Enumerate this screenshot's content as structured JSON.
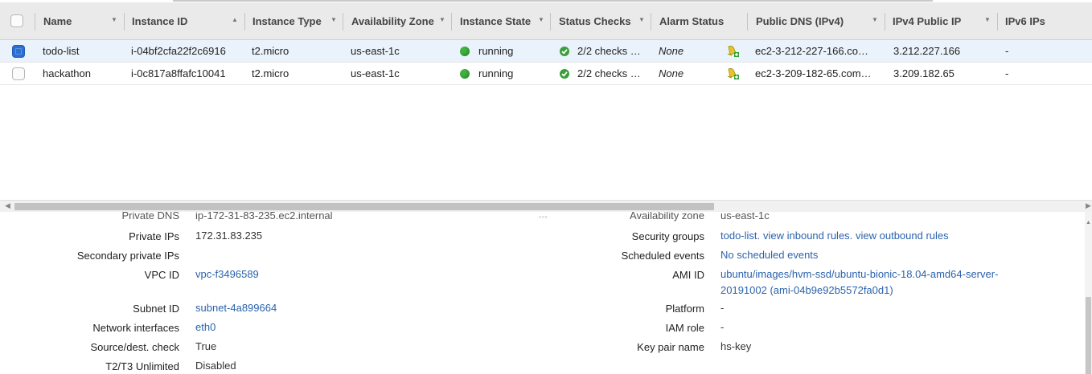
{
  "columns": [
    {
      "label": "Name"
    },
    {
      "label": "Instance ID"
    },
    {
      "label": "Instance Type"
    },
    {
      "label": "Availability Zone"
    },
    {
      "label": "Instance State"
    },
    {
      "label": "Status Checks"
    },
    {
      "label": "Alarm Status"
    },
    {
      "label": "Public DNS (IPv4)"
    },
    {
      "label": "IPv4 Public IP"
    },
    {
      "label": "IPv6 IPs"
    }
  ],
  "rows": [
    {
      "selected": true,
      "name": "todo-list",
      "instance_id": "i-04bf2cfa22f2c6916",
      "type": "t2.micro",
      "zone": "us-east-1c",
      "state": "running",
      "checks": "2/2 checks …",
      "alarm": "None",
      "dns": "ec2-3-212-227-166.co…",
      "ip": "3.212.227.166",
      "ipv6": "-"
    },
    {
      "selected": false,
      "name": "hackathon",
      "instance_id": "i-0c817a8ffafc10041",
      "type": "t2.micro",
      "zone": "us-east-1c",
      "state": "running",
      "checks": "2/2 checks …",
      "alarm": "None",
      "dns": "ec2-3-209-182-65.com…",
      "ip": "3.209.182.65",
      "ipv6": "-"
    }
  ],
  "details": {
    "cut_left_label": "Private DNS",
    "cut_left_value": "ip-172-31-83-235.ec2.internal",
    "cut_right_label": "Availability zone",
    "cut_right_value": "us-east-1c",
    "left": [
      {
        "label": "Private IPs",
        "value": "172.31.83.235"
      },
      {
        "label": "Secondary private IPs",
        "value": ""
      },
      {
        "label": "VPC ID",
        "value": "vpc-f3496589"
      },
      {
        "label": "Subnet ID",
        "value": "subnet-4a899664"
      },
      {
        "label": "Network interfaces",
        "value": "eth0"
      },
      {
        "label": "Source/dest. check",
        "value": "True"
      },
      {
        "label": "T2/T3 Unlimited",
        "value": "Disabled"
      }
    ],
    "right": {
      "security_groups_label": "Security groups",
      "security_groups_link1": "todo-list.",
      "security_groups_link2": "view inbound rules.",
      "security_groups_link3": "view outbound rules",
      "scheduled_label": "Scheduled events",
      "scheduled_value": "No scheduled events",
      "ami_label": "AMI ID",
      "ami_line1": "ubuntu/images/hvm-ssd/ubuntu-bionic-18.04-amd64-server-",
      "ami_line2": "20191002 (ami-04b9e92b5572fa0d1)",
      "platform_label": "Platform",
      "platform_value": "-",
      "iam_label": "IAM role",
      "iam_value": "-",
      "keypair_label": "Key pair name",
      "keypair_value": "hs-key"
    }
  },
  "colors": {
    "link": "#2b63ad",
    "selected_row": "#eaf2fb",
    "header": "#eaeaea",
    "running": "#3db23d"
  }
}
